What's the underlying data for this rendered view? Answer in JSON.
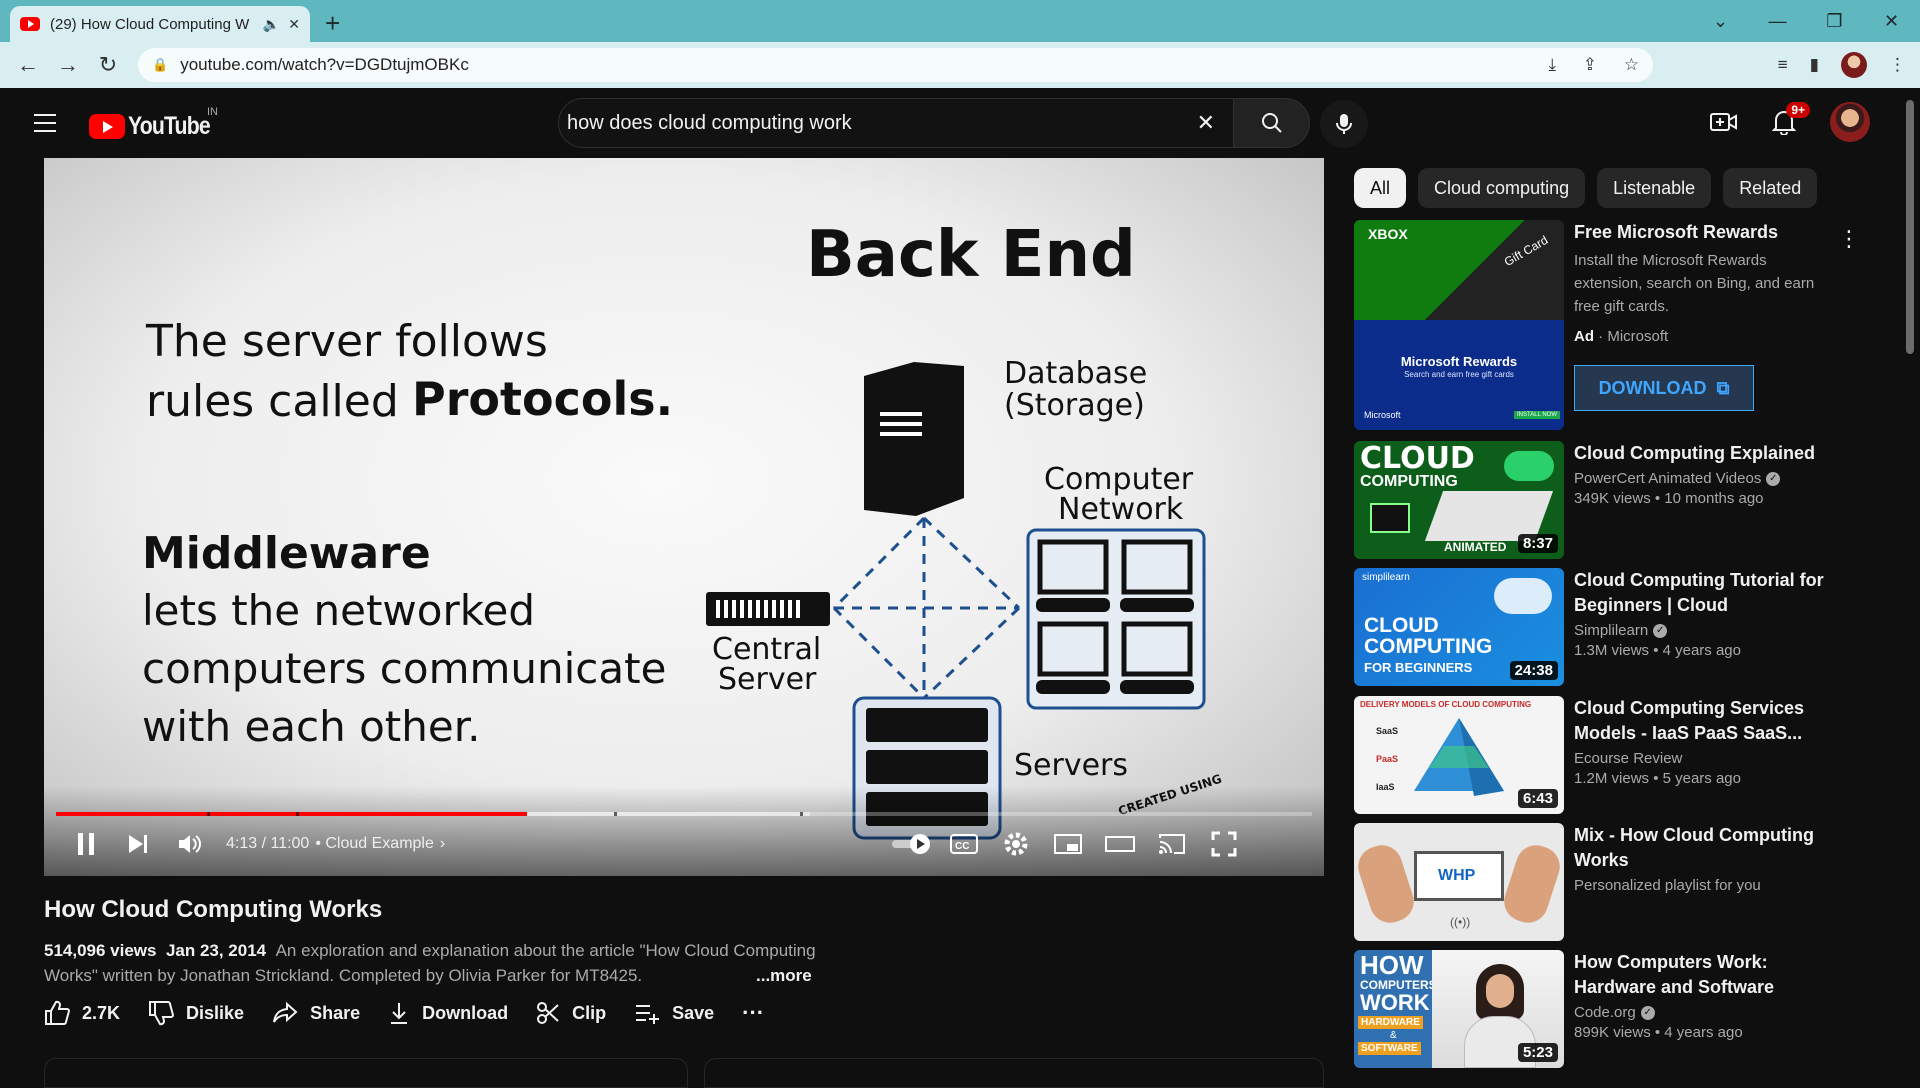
{
  "browser": {
    "tab_title": "(29) How Cloud Computing W",
    "url": "youtube.com/watch?v=DGDtujmOBKc"
  },
  "header": {
    "logo": "YouTube",
    "country": "IN",
    "search_value": "how does cloud computing work",
    "notifications_badge": "9+"
  },
  "player": {
    "slide": {
      "heading": "Back End",
      "line1": "The server follows",
      "line2a": "rules called",
      "line2b": "Protocols.",
      "middleware": "Middleware",
      "m1": "lets the networked",
      "m2": "computers communicate",
      "m3": "with each other.",
      "db1": "Database",
      "db2": "(Storage)",
      "cn1": "Computer",
      "cn2": "Network",
      "cs1": "Central",
      "cs2": "Server",
      "servers": "Servers",
      "watermark": "CREATED USING"
    },
    "time": "4:13 / 11:00",
    "chapter": "• Cloud Example",
    "played_fraction": 0.375
  },
  "video": {
    "title": "How Cloud Computing Works",
    "views": "514,096 views",
    "date": "Jan 23, 2014",
    "description": "An exploration and explanation about the article \"How Cloud Computing Works\" written by Jonathan Strickland. Completed by Olivia Parker for MT8425.",
    "more": "...more",
    "likes": "2.7K",
    "dislike": "Dislike",
    "share": "Share",
    "download": "Download",
    "clip": "Clip",
    "save": "Save"
  },
  "chips": [
    "All",
    "Cloud computing",
    "Listenable",
    "Related"
  ],
  "ad": {
    "title": "Free Microsoft Rewards",
    "text": "Install the Microsoft Rewards extension, search on Bing, and earn free gift cards.",
    "ad_label": "Ad",
    "advertiser": "Microsoft",
    "button": "DOWNLOAD",
    "thumb_top1": "XBOX",
    "thumb_top2": "Gift Card",
    "thumb_bottom1": "Microsoft Rewards",
    "thumb_bottom2": "Search and earn free gift cards",
    "thumb_brand": "Microsoft",
    "thumb_cta": "INSTALL NOW"
  },
  "recommendations": [
    {
      "title": "Cloud Computing Explained",
      "channel": "PowerCert Animated Videos",
      "verified": true,
      "meta": "349K views • 10 months ago",
      "duration": "8:37",
      "thumb_text": [
        "CLOUD",
        "COMPUTING",
        "ANIMATED"
      ]
    },
    {
      "title": "Cloud Computing Tutorial for Beginners | Cloud Computing...",
      "channel": "Simplilearn",
      "verified": true,
      "meta": "1.3M views • 4 years ago",
      "duration": "24:38",
      "thumb_text": [
        "CLOUD",
        "COMPUTING",
        "FOR BEGINNERS",
        "simplilearn"
      ]
    },
    {
      "title": "Cloud Computing Services Models - IaaS PaaS SaaS...",
      "channel": "Ecourse Review",
      "verified": false,
      "meta": "1.2M views • 5 years ago",
      "duration": "6:43",
      "thumb_text": [
        "DELIVERY MODELS OF CLOUD COMPUTING",
        "SaaS",
        "PaaS",
        "IaaS"
      ]
    },
    {
      "title": "Mix - How Cloud Computing Works",
      "channel": "Personalized playlist for you",
      "verified": false,
      "meta": "",
      "duration": "",
      "thumb_text": [
        "WHP"
      ]
    },
    {
      "title": "How Computers Work: Hardware and Software",
      "channel": "Code.org",
      "verified": true,
      "meta": "899K views • 4 years ago",
      "duration": "5:23",
      "thumb_text": [
        "HOW",
        "COMPUTERS",
        "WORK",
        "HARDWARE",
        "&",
        "SOFTWARE"
      ]
    }
  ],
  "colors": {
    "accent": "#ff0000",
    "background": "#0f0f0f",
    "link_blue": "#3ea6ff",
    "browser_teal": "#5fb8bf"
  }
}
